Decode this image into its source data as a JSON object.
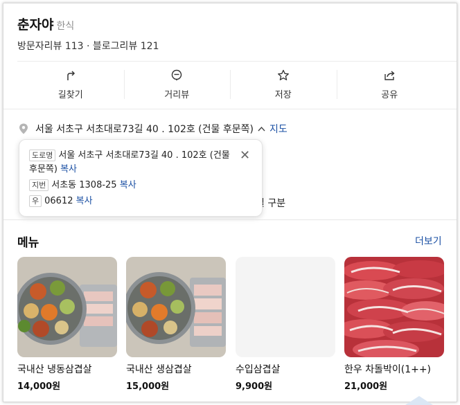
{
  "header": {
    "name": "춘자야",
    "category": "한식",
    "reviews": "방문자리뷰 113 · 블로그리뷰 121"
  },
  "actions": [
    {
      "label": "길찾기",
      "icon": "directions-icon"
    },
    {
      "label": "거리뷰",
      "icon": "street-view-icon"
    },
    {
      "label": "저장",
      "icon": "star-icon"
    },
    {
      "label": "공유",
      "icon": "share-icon"
    }
  ],
  "address": {
    "text": "서울 서초구 서초대로73길 40 . 102호 (건물 후문쪽)",
    "toggle": "^",
    "map_link": "지도"
  },
  "address_popup": {
    "road_tag": "도로명",
    "road_line1": "서울 서초구 서초대로73길 40 . 102호 (건물",
    "road_line2": "후문쪽)",
    "jibun_tag": "지번",
    "jibun": "서초동 1308-25",
    "zip_tag": "우",
    "zip": "06612",
    "copy": "복사",
    "close": "✕"
  },
  "hidden_fragment": "실 구분",
  "menu": {
    "title": "메뉴",
    "more": "더보기",
    "items": [
      {
        "name": "국내산 냉동삼겹살",
        "price": "14,000원"
      },
      {
        "name": "국내산 생삼겹살",
        "price": "15,000원"
      },
      {
        "name": "수입삼겹살",
        "price": "9,900원"
      },
      {
        "name": "한우 차돌박이(1++)",
        "price": "21,000원"
      }
    ]
  },
  "colors": {
    "link": "#1a4fa3",
    "divider": "#ebebeb",
    "muted": "#8f8f8f"
  }
}
